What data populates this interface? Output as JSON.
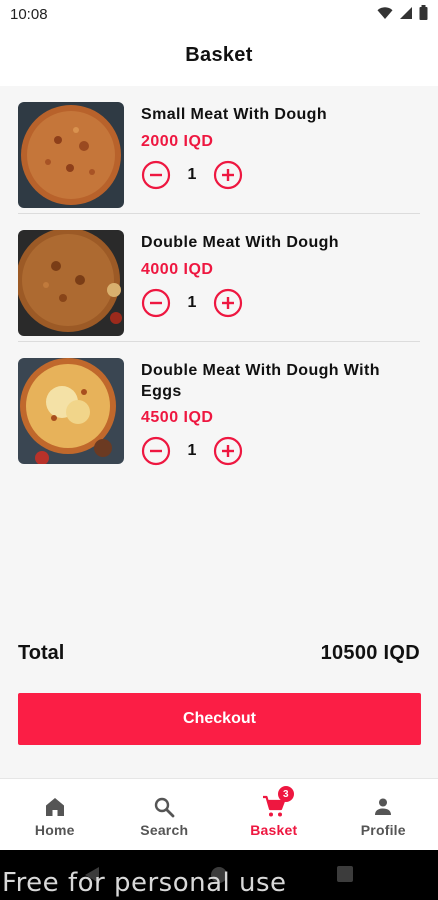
{
  "status_bar": {
    "time": "10:08",
    "icons": [
      "wifi-icon",
      "signal-icon",
      "battery-icon"
    ]
  },
  "header": {
    "title": "Basket"
  },
  "items": [
    {
      "name": "Small Meat With Dough",
      "price": "2000 IQD",
      "quantity": "1",
      "image": "lahmacun-small-image"
    },
    {
      "name": "Double Meat With Dough",
      "price": "4000 IQD",
      "quantity": "1",
      "image": "lahmacun-double-image"
    },
    {
      "name": "Double Meat With Dough With Eggs",
      "price": "4500 IQD",
      "quantity": "1",
      "image": "lahmacun-eggs-image"
    }
  ],
  "summary": {
    "total_label": "Total",
    "total_value": "10500 IQD"
  },
  "checkout": {
    "label": "Checkout"
  },
  "bottom_nav": {
    "items": [
      {
        "label": "Home",
        "icon": "home-icon"
      },
      {
        "label": "Search",
        "icon": "search-icon"
      },
      {
        "label": "Basket",
        "icon": "cart-icon",
        "badge": "3",
        "active": true
      },
      {
        "label": "Profile",
        "icon": "person-icon"
      }
    ]
  },
  "watermark": "Free for personal use",
  "colors": {
    "accent": "#ee1740",
    "checkout": "#fb1e45",
    "background": "#f6f6f6"
  }
}
